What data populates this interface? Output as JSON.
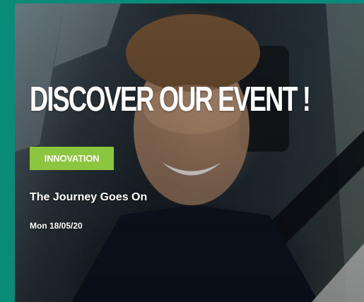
{
  "card": {
    "heading": "DISCOVER OUR EVENT !",
    "category": "INNOVATION",
    "event_title": "The Journey Goes On",
    "event_date": "Mon 18/05/20"
  },
  "colors": {
    "frame_accent": "#0a8a78",
    "badge": "#8cc63f",
    "text": "#ffffff"
  },
  "icons": {
    "hero_image": "photo-man-driving-car"
  }
}
